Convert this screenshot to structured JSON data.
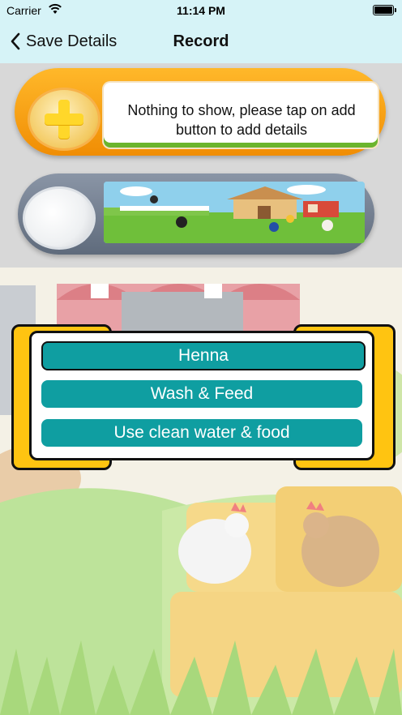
{
  "status_bar": {
    "carrier": "Carrier",
    "time": "11:14 PM"
  },
  "nav": {
    "back_label": "Save Details",
    "title": "Record"
  },
  "cards": {
    "add_card": {
      "message": "Nothing to show, please tap on add button to add details"
    }
  },
  "items": [
    {
      "label": "Henna"
    },
    {
      "label": "Wash & Feed"
    },
    {
      "label": "Use clean water & food"
    }
  ],
  "colors": {
    "nav_background": "#d6f3f7",
    "add_card": "#f7a51a",
    "item_button": "#0f9ea1",
    "frame_yellow": "#ffc411"
  }
}
